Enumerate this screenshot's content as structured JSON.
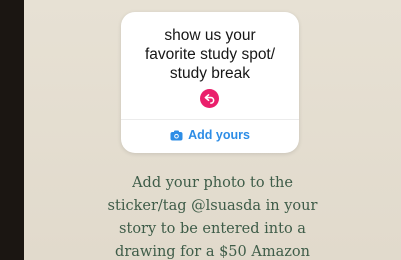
{
  "sticker": {
    "prompt": "show us your\nfavorite study spot/\nstudy break",
    "reply_icon": "reply-arrow-icon",
    "action_icon": "camera-icon",
    "action_label": "Add yours",
    "accent_color": "#ea1f6b",
    "link_color": "#2d8de6"
  },
  "caption": "Add your photo to the\nsticker/tag @lsuasda in your\nstory to be entered into a\ndrawing for a $50 Amazon"
}
